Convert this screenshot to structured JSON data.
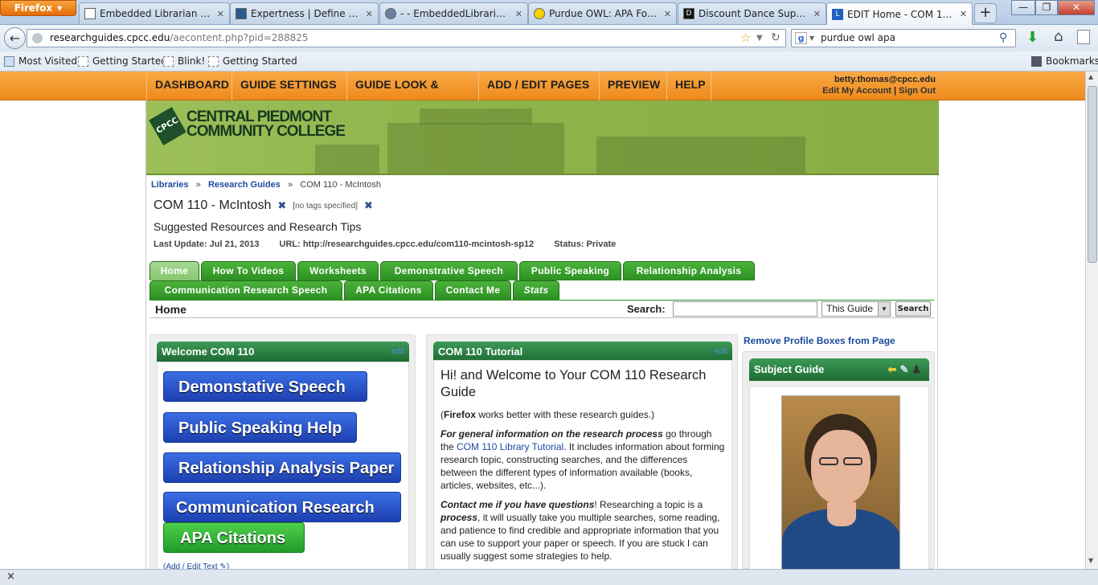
{
  "browser": {
    "app_button": "Firefox",
    "tabs": [
      {
        "title": "Embedded Librarian artic...",
        "active": false
      },
      {
        "title": "Expertness | Define Expert...",
        "active": false
      },
      {
        "title": "- - EmbeddedLibrariansh...",
        "active": false
      },
      {
        "title": "Purdue OWL: APA Forma...",
        "active": false
      },
      {
        "title": "Discount Dance Supply - ...",
        "active": false
      },
      {
        "title": "EDIT Home - COM 110 - ...",
        "active": true
      }
    ],
    "new_tab": "+",
    "url_domain": "researchguides.cpcc.edu",
    "url_path": "/aecontent.php?pid=288825",
    "search_value": "purdue owl apa",
    "bookmarks": [
      "Most Visited",
      "Getting Started",
      "Blink!",
      "Getting Started"
    ],
    "bookmarks_menu": "Bookmarks",
    "status": "×"
  },
  "admin": {
    "menu": [
      "DASHBOARD",
      "GUIDE SETTINGS ▾",
      "GUIDE LOOK & FEEL ▾",
      "ADD / EDIT PAGES ▾",
      "PREVIEW",
      "HELP"
    ],
    "user_email": "betty.thomas@cpcc.edu",
    "edit_account": "Edit My Account",
    "separator": "|",
    "sign_out": "Sign Out"
  },
  "banner": {
    "logo_mark": "CPCC",
    "line1": "CENTRAL PIEDMONT",
    "line2": "COMMUNITY COLLEGE"
  },
  "breadcrumb": {
    "items": [
      "Libraries",
      "Research Guides",
      "COM 110 - McIntosh"
    ],
    "sep": "»"
  },
  "guide": {
    "title": "COM 110 - McIntosh",
    "tags": "[no tags specified]",
    "description": "Suggested Resources and Research Tips",
    "last_update": "Last Update: Jul 21, 2013",
    "url": "URL: http://researchguides.cpcc.edu/com110-mcintosh-sp12",
    "status": "Status: Private"
  },
  "page_tabs": [
    "Home",
    "How To Videos",
    "Worksheets",
    "Demonstrative Speech",
    "Public Speaking",
    "Relationship Analysis",
    "Communication Research Speech",
    "APA Citations",
    "Contact Me",
    "Stats"
  ],
  "page_header": {
    "name": "Home",
    "search_label": "Search:",
    "search_value": "",
    "scope": "This Guide",
    "search_button": "Search"
  },
  "welcome_box": {
    "title": "Welcome COM 110",
    "edit": "edit",
    "buttons": [
      "Demonstative Speech",
      "Public Speaking Help",
      "Relationship Analysis Paper",
      "Communication Research Speech",
      "APA Citations"
    ],
    "add_edit": "(Add / Edit Text"
  },
  "tutorial_box": {
    "title": "COM 110 Tutorial",
    "edit": "edit",
    "heading": "Hi! and Welcome to Your COM 110 Research Guide",
    "p1_bold": "Firefox",
    "p1_rest": " works better with these research guides.)",
    "p1_open": "(",
    "p2_em": "For general information on the research process",
    "p2_a": " go through the ",
    "p2_link": "COM 110 Library Tutorial",
    "p2_b": ". It includes information about forming research topic, constructing searches, and the differences between the different types of information available (books, articles, websites, etc...).",
    "p3_em": "Contact me if you have questions",
    "p3_a": "! Researching a topic is a ",
    "p3_em2": "process",
    "p3_b": ", it will usually take you multiple searches, some reading, and patience to find credible and appropriate information that you can use to support your paper or speech. If you are stuck I can usually suggest some strategies to help."
  },
  "sidebar": {
    "remove_profile": "Remove Profile Boxes from Page",
    "subject_guide_title": "Subject Guide"
  },
  "colors": {
    "admin_orange": "#f39a2e",
    "tab_green": "#2c8f22",
    "box_green": "#1e6b34",
    "link_blue": "#1a4a9c",
    "button_blue": "#1d3fb0",
    "button_green": "#1f9c2a"
  }
}
